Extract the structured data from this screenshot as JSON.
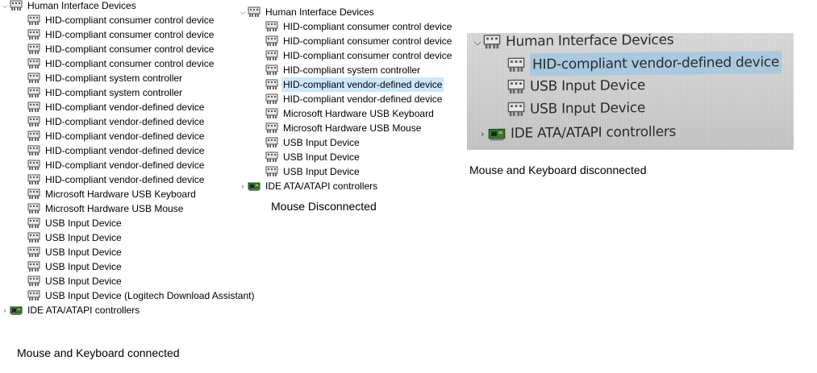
{
  "left_panel": {
    "root_label": "Human Interface Devices",
    "children": [
      "HID-compliant consumer control device",
      "HID-compliant consumer control device",
      "HID-compliant consumer control device",
      "HID-compliant consumer control device",
      "HID-compliant system controller",
      "HID-compliant system controller",
      "HID-compliant vendor-defined device",
      "HID-compliant vendor-defined device",
      "HID-compliant vendor-defined device",
      "HID-compliant vendor-defined device",
      "HID-compliant vendor-defined device",
      "HID-compliant vendor-defined device",
      "Microsoft Hardware USB Keyboard",
      "Microsoft Hardware USB Mouse",
      "USB Input Device",
      "USB Input Device",
      "USB Input Device",
      "USB Input Device",
      "USB Input Device",
      "USB Input Device (Logitech Download Assistant)"
    ],
    "sibling_label": "IDE ATA/ATAPI controllers",
    "caption": "Mouse and Keyboard connected"
  },
  "middle_panel": {
    "root_label": "Human Interface Devices",
    "children": [
      "HID-compliant consumer control device",
      "HID-compliant consumer control device",
      "HID-compliant consumer control device",
      "HID-compliant system controller",
      "HID-compliant vendor-defined device",
      "HID-compliant vendor-defined device",
      "Microsoft Hardware USB Keyboard",
      "Microsoft Hardware USB Mouse",
      "USB Input Device",
      "USB Input Device",
      "USB Input Device"
    ],
    "selected_index": 4,
    "sibling_label": "IDE ATA/ATAPI controllers",
    "caption": "Mouse Disconnected"
  },
  "right_panel": {
    "root_label": "Human Interface Devices",
    "children": [
      "HID-compliant vendor-defined device",
      "USB Input Device",
      "USB Input Device"
    ],
    "selected_index": 0,
    "sibling_label": "IDE ATA/ATAPI controllers",
    "caption": "Mouse and Keyboard disconnected"
  },
  "icons": {
    "expanded": "chevron-down-icon",
    "collapsed": "chevron-right-icon",
    "hid": "hid-device-icon",
    "ide": "ide-controller-icon"
  },
  "colors": {
    "selection": "#cce8ff",
    "photo_selection": "#a9c9df"
  }
}
